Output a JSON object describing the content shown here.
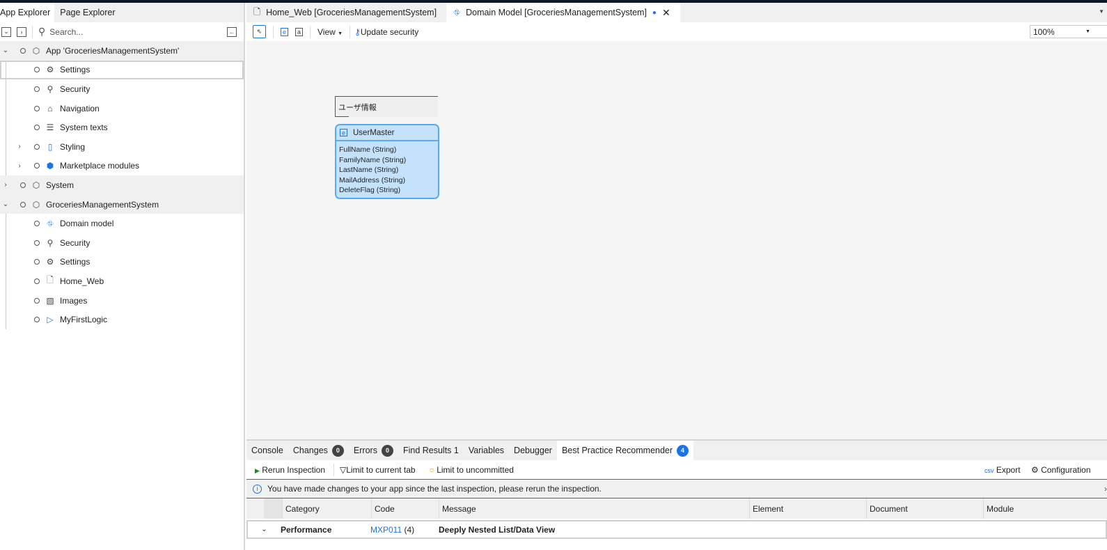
{
  "left": {
    "tabs": [
      "App Explorer",
      "Page Explorer"
    ],
    "search_placeholder": "Search...",
    "tree": [
      {
        "label": "App 'GroceriesManagementSystem'",
        "level": 0,
        "expand": "open",
        "icon": "cube-icon"
      },
      {
        "label": "Settings",
        "level": 1,
        "icon": "gear-icon",
        "selected": true
      },
      {
        "label": "Security",
        "level": 1,
        "icon": "key-icon"
      },
      {
        "label": "Navigation",
        "level": 1,
        "icon": "home-icon"
      },
      {
        "label": "System texts",
        "level": 1,
        "icon": "text-icon"
      },
      {
        "label": "Styling",
        "level": 1,
        "expand": "closed",
        "icon": "styling-icon"
      },
      {
        "label": "Marketplace modules",
        "level": 1,
        "expand": "closed",
        "icon": "marketplace-icon"
      },
      {
        "label": "System",
        "level": 0,
        "expand": "closed",
        "icon": "system-module-icon"
      },
      {
        "label": "GroceriesManagementSystem",
        "level": 0,
        "expand": "open",
        "icon": "module-icon"
      },
      {
        "label": "Domain model",
        "level": 1,
        "icon": "domain-model-icon"
      },
      {
        "label": "Security",
        "level": 1,
        "icon": "key-icon"
      },
      {
        "label": "Settings",
        "level": 1,
        "icon": "gear-icon"
      },
      {
        "label": "Home_Web",
        "level": 1,
        "icon": "page-icon"
      },
      {
        "label": "Images",
        "level": 1,
        "icon": "image-icon"
      },
      {
        "label": "MyFirstLogic",
        "level": 1,
        "icon": "microflow-icon"
      }
    ]
  },
  "editor": {
    "tabs": [
      "Home_Web [GroceriesManagementSystem]",
      "Domain Model [GroceriesManagementSystem]"
    ],
    "toolbar": {
      "view": "View",
      "update_security": "Update security",
      "zoom": "100%"
    },
    "annotation": "ユーザ情報",
    "entity": {
      "name": "UserMaster",
      "attributes": [
        "FullName (String)",
        "FamilyName (String)",
        "LastName (String)",
        "MailAddress (String)",
        "DeleteFlag (String)"
      ]
    }
  },
  "bottom": {
    "tabs": [
      {
        "label": "Console"
      },
      {
        "label": "Changes",
        "badge": "0"
      },
      {
        "label": "Errors",
        "badge": "0"
      },
      {
        "label": "Find Results 1"
      },
      {
        "label": "Variables"
      },
      {
        "label": "Debugger"
      },
      {
        "label": "Best Practice Recommender",
        "badge": "4"
      }
    ],
    "toolbar": {
      "rerun": "Rerun Inspection",
      "limit_tab": "Limit to current tab",
      "limit_uncommitted": "Limit to uncommitted",
      "export": "Export",
      "configuration": "Configuration"
    },
    "info": "You have made changes to your app since the last inspection, please rerun the inspection.",
    "columns": [
      "Category",
      "Code",
      "Message",
      "Element",
      "Document",
      "Module"
    ],
    "rows": [
      {
        "category": "Performance",
        "code": "MXP011",
        "count": "(4)",
        "message": "Deeply Nested List/Data View"
      }
    ]
  },
  "colors": {
    "accent": "#1a73e8",
    "entity_fill": "#c5e2fc",
    "entity_border": "#5aaaf0"
  }
}
